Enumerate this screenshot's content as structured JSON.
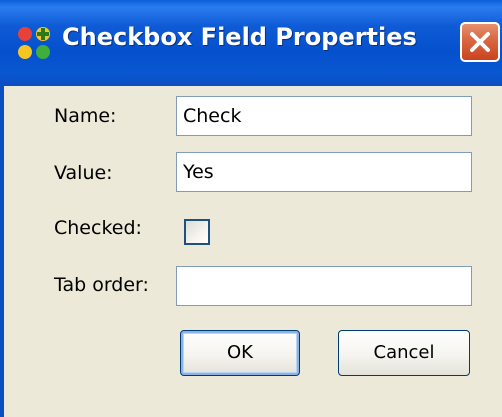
{
  "dialog": {
    "title": "Checkbox Field Properties",
    "icon": "app-icon"
  },
  "fields": {
    "name_label": "Name:",
    "name_value": "Check",
    "value_label": "Value:",
    "value_value": "Yes",
    "checked_label": "Checked:",
    "checked": false,
    "tab_order_label": "Tab order:",
    "tab_order_value": ""
  },
  "buttons": {
    "ok_label": "OK",
    "cancel_label": "Cancel"
  },
  "colors": {
    "titlebar": "#0550cd",
    "window_bg": "#ece9d8",
    "close_button": "#d96a45"
  }
}
